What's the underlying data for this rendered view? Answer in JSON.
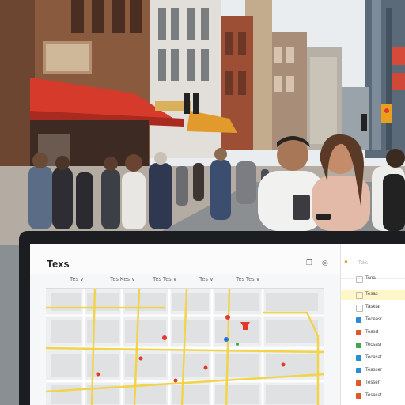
{
  "scene": {
    "sky": "#e8ecef",
    "awning_color": "#d63a2b",
    "shop_sign_text": ""
  },
  "app": {
    "title": "Texs",
    "header_icons": [
      "copy-icon",
      "location-pin-icon"
    ],
    "filters": [
      {
        "label": "Tes"
      },
      {
        "label": "Tes Kes"
      },
      {
        "label": "Tes Tes"
      },
      {
        "label": "Tes"
      },
      {
        "label": "Tes Tes"
      }
    ]
  },
  "sidebar": {
    "search_placeholder": "Tcks",
    "items": [
      {
        "label": "Tsna",
        "color": "#ffffff",
        "active": false
      },
      {
        "label": "Tesas",
        "color": "#ffffff",
        "active": true
      },
      {
        "label": "Tasktat",
        "color": "#ffffff",
        "active": false
      },
      {
        "label": "Teceasr",
        "color": "#2a8bd6",
        "active": false
      },
      {
        "label": "Teasrt",
        "color": "#e0572c",
        "active": false
      },
      {
        "label": "Tecsasr",
        "color": "#3fa84b",
        "active": false
      },
      {
        "label": "Tecasat",
        "color": "#2a8bd6",
        "active": false
      },
      {
        "label": "Teasser",
        "color": "#2a8bd6",
        "active": false
      },
      {
        "label": "Tessert",
        "color": "#e0572c",
        "active": false
      },
      {
        "label": "Tesacat",
        "color": "#e0572c",
        "active": false
      }
    ]
  },
  "map": {
    "road_color": "#f2d44a",
    "pin_color": "#e23a2a"
  }
}
